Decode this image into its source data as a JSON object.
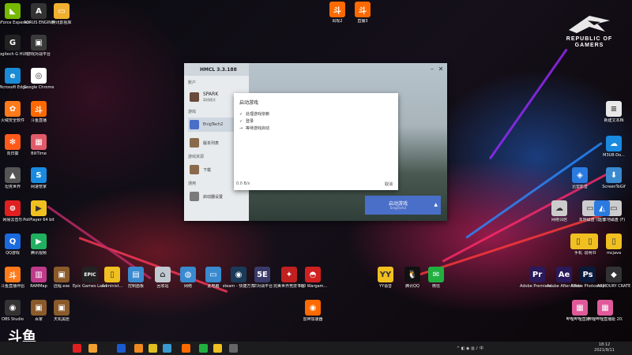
{
  "desktop": {
    "left_icons": [
      {
        "label": "GeForce Experience",
        "color": "#76b900",
        "glyph": "◣"
      },
      {
        "label": "AORUS ENGINE",
        "color": "#333333",
        "glyph": "A"
      },
      {
        "label": "腾讯影视库",
        "color": "#f0b030",
        "glyph": "▭"
      },
      {
        "label": "Logitech G HUB",
        "color": "#222222",
        "glyph": "G"
      },
      {
        "label": "游戏对战平台",
        "color": "#3a3a3a",
        "glyph": "▣"
      },
      {
        "label": "Microsoft Edge",
        "color": "#1a8bd6",
        "glyph": "e"
      },
      {
        "label": "Google Chrome",
        "color": "#ffffff",
        "glyph": "◎"
      },
      {
        "label": "火绒安全软件",
        "color": "#ff7a1a",
        "glyph": "✿"
      },
      {
        "label": "斗鱼直播",
        "color": "#ff6a00",
        "glyph": "斗"
      },
      {
        "label": "向日葵",
        "color": "#ff5a1a",
        "glyph": "✻"
      },
      {
        "label": "BiliTime",
        "color": "#e05a6a",
        "glyph": "▦"
      },
      {
        "label": "坦克世界",
        "color": "#555555",
        "glyph": "▲"
      },
      {
        "label": "网速管家",
        "color": "#1a8ae0",
        "glyph": "S"
      },
      {
        "label": "网易云音乐",
        "color": "#e02020",
        "glyph": "⊚"
      },
      {
        "label": "PotPlayer 64 bit",
        "color": "#f0c020",
        "glyph": "▶"
      },
      {
        "label": "QQ游戏",
        "color": "#1a6ae0",
        "glyph": "Q"
      },
      {
        "label": "腾讯视频",
        "color": "#20b060",
        "glyph": "▶"
      },
      {
        "label": "斗鱼直播伴侣",
        "color": "#ff7a1a",
        "glyph": "斗"
      },
      {
        "label": "RAMMap",
        "color": "#c03a8a",
        "glyph": "▥"
      },
      {
        "label": "OBS Studio",
        "color": "#333333",
        "glyph": "◉"
      },
      {
        "label": "百家",
        "color": "#8a5a2a",
        "glyph": "▣"
      },
      {
        "label": "天机黑匣",
        "color": "#8a5a2a",
        "glyph": "▣"
      }
    ],
    "bottom_row_icons": [
      {
        "label": "远程.exe",
        "color": "#8a5a2a",
        "glyph": "▣"
      },
      {
        "label": "Epic Games Launcher",
        "color": "#222222",
        "glyph": "EPIC"
      },
      {
        "label": "Administ...",
        "color": "#f0c020",
        "glyph": "▯"
      },
      {
        "label": "控制面板",
        "color": "#3a8ad0",
        "glyph": "▤"
      },
      {
        "label": "回收站",
        "color": "#c0c8d0",
        "glyph": "⌂"
      },
      {
        "label": "网络",
        "color": "#3a8ad0",
        "glyph": "◍"
      },
      {
        "label": "此电脑",
        "color": "#3a8ad0",
        "glyph": "▭"
      },
      {
        "label": "steam - 快捷方式",
        "color": "#1a3a5a",
        "glyph": "◉"
      },
      {
        "label": "5E对战平台",
        "color": "#3a3a6a",
        "glyph": "5E"
      },
      {
        "label": "完美世界竞技平台",
        "color": "#c02020",
        "glyph": "✦"
      },
      {
        "label": "360 Wargam...",
        "color": "#d02020",
        "glyph": "◓"
      },
      {
        "label": "雷神加速器",
        "color": "#ff6a00",
        "glyph": "◉"
      }
    ],
    "right_icons": [
      {
        "label": "YY语音",
        "color": "#f0c020",
        "glyph": "YY"
      },
      {
        "label": "腾讯QQ",
        "color": "#111111",
        "glyph": "🐧"
      },
      {
        "label": "微信",
        "color": "#20b040",
        "glyph": "✉"
      },
      {
        "label": "Adobe Premiere...",
        "color": "#2a1a5a",
        "glyph": "Pr"
      },
      {
        "label": "Adobe After Effects...",
        "color": "#2a1a5a",
        "glyph": "Ae"
      },
      {
        "label": "Adobe Photoshop",
        "color": "#0a1a3a",
        "glyph": "Ps"
      },
      {
        "label": "ARMOURY CRATE",
        "color": "#333333",
        "glyph": "◆"
      },
      {
        "label": "新建文本档",
        "color": "#e8e8e8",
        "glyph": "≡"
      },
      {
        "label": "M3U8-Do...",
        "color": "#1a8ae0",
        "glyph": "☁"
      },
      {
        "label": "迅雷影音",
        "color": "#2a7ae0",
        "glyph": "◈"
      },
      {
        "label": "ScreenToGif",
        "color": "#3a8ad0",
        "glyph": "⬇"
      },
      {
        "label": "本地磁盘 (E)",
        "color": "#cccccc",
        "glyph": "▭"
      },
      {
        "label": "本地磁盘 (F)",
        "color": "#cccccc",
        "glyph": "▭"
      },
      {
        "label": "网络邻居",
        "color": "#cccccc",
        "glyph": "☁"
      },
      {
        "label": "迅雷",
        "color": "#2a7ae0",
        "glyph": "◭"
      },
      {
        "label": "mcjava",
        "color": "#f0c020",
        "glyph": "▯"
      },
      {
        "label": "手机",
        "color": "#f0c020",
        "glyph": "▯"
      },
      {
        "label": "说明书",
        "color": "#f0c020",
        "glyph": "▯"
      },
      {
        "label": "哔哩哔哩直播...",
        "color": "#e05a9a",
        "glyph": "▦"
      },
      {
        "label": "哔哩哔哩直播姬 2021...",
        "color": "#e05a9a",
        "glyph": "▦"
      }
    ],
    "top_icons": [
      {
        "label": "出现2",
        "color": "#ff6a00",
        "glyph": "斗"
      },
      {
        "label": "直播3",
        "color": "#ff6a00",
        "glyph": "斗"
      }
    ],
    "rog": {
      "line1": "REPUBLIC OF",
      "line2": "GAMERS"
    }
  },
  "hmcl": {
    "title": "HMCL 3.3.188",
    "side_section_account": "账户",
    "account_name": "SPARK",
    "account_sub": "离线模式",
    "side_section_game": "游戏",
    "game_name": "EnigTech2",
    "version_list": "版本列表",
    "side_section_download": "游戏资源",
    "download": "下载",
    "side_section_general": "通用",
    "launcher_settings": "启动器设置",
    "launch_button": "启动游戏",
    "launch_sub": "EnigTech2",
    "launch_arrow": "▲"
  },
  "dialog": {
    "title": "启动游戏",
    "steps": [
      {
        "mark": "✓",
        "text": "处理游戏依赖"
      },
      {
        "mark": "✓",
        "text": "登录"
      },
      {
        "mark": "→",
        "text": "等待游戏启动"
      }
    ],
    "speed": "0.0 B/s",
    "cancel": "取消"
  },
  "taskbar": {
    "icons": [
      {
        "color": "#e02020"
      },
      {
        "color": "#f0a030"
      },
      {
        "color": "#1a5ad0"
      },
      {
        "color": "#f08a20"
      },
      {
        "color": "#e0c020"
      },
      {
        "color": "#3a9ad0"
      },
      {
        "color": "#ff6a00"
      },
      {
        "color": "#20b040"
      },
      {
        "color": "#f0c020"
      },
      {
        "color": "#666666"
      }
    ],
    "time": "18:12",
    "date": "2021/9/11",
    "tray_glyph": "^ ◧ ◉ ▥ ♪ 中"
  },
  "watermark": "斗鱼"
}
